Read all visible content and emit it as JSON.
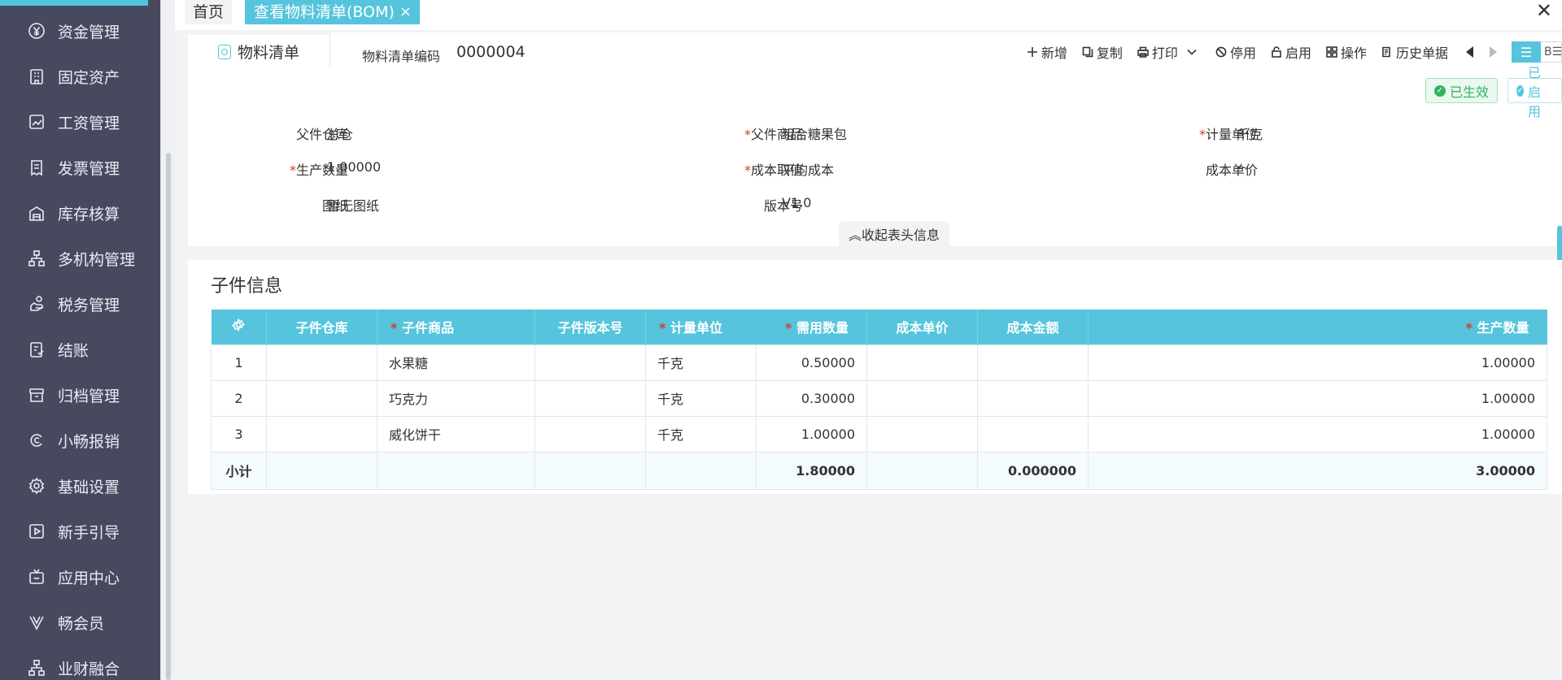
{
  "sidebar": {
    "items": [
      {
        "label": "资金管理",
        "icon": "yen-circle-icon"
      },
      {
        "label": "固定资产",
        "icon": "building-icon"
      },
      {
        "label": "工资管理",
        "icon": "salary-chart-icon"
      },
      {
        "label": "发票管理",
        "icon": "invoice-icon"
      },
      {
        "label": "库存核算",
        "icon": "warehouse-icon"
      },
      {
        "label": "多机构管理",
        "icon": "org-tree-icon"
      },
      {
        "label": "税务管理",
        "icon": "tax-hand-icon"
      },
      {
        "label": "结账",
        "icon": "closing-doc-icon"
      },
      {
        "label": "归档管理",
        "icon": "archive-box-icon"
      },
      {
        "label": "小畅报销",
        "icon": "reimburse-c-icon"
      },
      {
        "label": "基础设置",
        "icon": "settings-gear-icon"
      },
      {
        "label": "新手引导",
        "icon": "play-guide-icon"
      },
      {
        "label": "应用中心",
        "icon": "app-tv-icon"
      },
      {
        "label": "畅会员",
        "icon": "vip-v-icon"
      },
      {
        "label": "业财融合",
        "icon": "integration-icon"
      }
    ]
  },
  "tabs": {
    "home": "首页",
    "active": "查看物料清单(BOM)",
    "close_glyph": "×",
    "window_close_glyph": "✕"
  },
  "header": {
    "sub_tab": "物料清单",
    "code_label": "物料清单编码",
    "code_value": "0000004"
  },
  "toolbar": {
    "new": "新增",
    "copy": "复制",
    "print": "打印",
    "disable": "停用",
    "enable": "启用",
    "operate": "操作",
    "history": "历史单据",
    "list_view_glyph": "☰",
    "card_view_text": "B☰"
  },
  "status": {
    "effective": "已生效",
    "enabled": "已启用",
    "check_glyph": "✓"
  },
  "form": {
    "parent_warehouse_label": "父件仓库",
    "parent_warehouse_value": "总仓",
    "parent_product_label": "父件商品",
    "parent_product_value": "组合糖果包",
    "unit_label": "计量单位",
    "unit_value": "千克",
    "prod_qty_label": "生产数量",
    "prod_qty_value": "1.00000",
    "cost_method_label": "成本取值",
    "cost_method_value": "平均成本",
    "unit_cost_label": "成本单价",
    "unit_cost_value": "--",
    "drawing_label": "图纸",
    "drawing_value": "暂无图纸",
    "version_label": "版本号",
    "version_value": "V1.0",
    "required_mark": "*"
  },
  "collapse": {
    "label": "收起表头信息",
    "glyph": "︽"
  },
  "children": {
    "title": "子件信息",
    "columns": {
      "warehouse": "子件仓库",
      "product": "子件商品",
      "version": "子件版本号",
      "unit": "计量单位",
      "req_qty": "需用数量",
      "unit_cost": "成本单价",
      "cost_amount": "成本金额",
      "prod_qty": "生产数量"
    },
    "rows": [
      {
        "no": "1",
        "warehouse": "",
        "product": "水果糖",
        "version": "",
        "unit": "千克",
        "req_qty": "0.50000",
        "unit_cost": "",
        "cost_amount": "",
        "prod_qty": "1.00000"
      },
      {
        "no": "2",
        "warehouse": "",
        "product": "巧克力",
        "version": "",
        "unit": "千克",
        "req_qty": "0.30000",
        "unit_cost": "",
        "cost_amount": "",
        "prod_qty": "1.00000"
      },
      {
        "no": "3",
        "warehouse": "",
        "product": "威化饼干",
        "version": "",
        "unit": "千克",
        "req_qty": "1.00000",
        "unit_cost": "",
        "cost_amount": "",
        "prod_qty": "1.00000"
      }
    ],
    "summary": {
      "label": "小计",
      "req_qty": "1.80000",
      "cost_amount": "0.000000",
      "prod_qty": "3.00000"
    }
  },
  "colors": {
    "accent": "#56c4dd",
    "sidebar_bg": "#474a5f",
    "required": "#e0352b",
    "success": "#2fb560"
  }
}
